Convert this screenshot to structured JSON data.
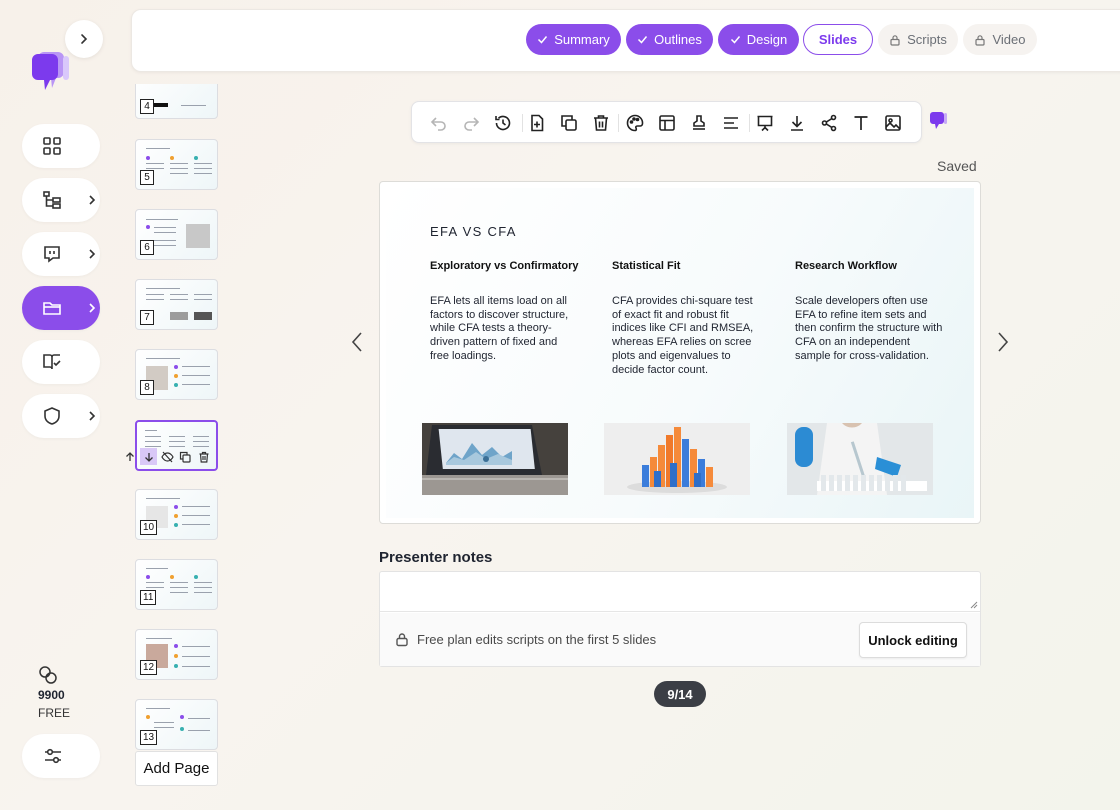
{
  "rail": {
    "items": [
      {
        "icon": "grid-icon",
        "has_chevron": false,
        "active": false
      },
      {
        "icon": "hierarchy-icon",
        "has_chevron": true,
        "active": false
      },
      {
        "icon": "chat-icon",
        "has_chevron": true,
        "active": false
      },
      {
        "icon": "folder-icon",
        "has_chevron": true,
        "active": true
      },
      {
        "icon": "book-check-icon",
        "has_chevron": false,
        "active": false
      },
      {
        "icon": "shield-icon",
        "has_chevron": true,
        "active": false
      }
    ],
    "credits": "9900",
    "plan": "FREE"
  },
  "steps": [
    {
      "label": "Summary",
      "state": "done"
    },
    {
      "label": "Outlines",
      "state": "done"
    },
    {
      "label": "Design",
      "state": "done"
    },
    {
      "label": "Slides",
      "state": "current"
    },
    {
      "label": "Scripts",
      "state": "locked"
    },
    {
      "label": "Video",
      "state": "locked"
    }
  ],
  "thumbnails": [
    "4",
    "5",
    "6",
    "7",
    "8",
    "",
    "10",
    "11",
    "12",
    "13"
  ],
  "selected_slide_index": 9,
  "add_page_label": "Add Page",
  "toolbar": {
    "tools": [
      "undo-icon",
      "redo-icon",
      "history-icon",
      "add-slide-icon",
      "duplicate-icon",
      "delete-icon",
      "palette-icon",
      "layout-icon",
      "stamp-icon",
      "align-icon",
      "present-icon",
      "download-icon",
      "share-icon",
      "text-icon",
      "image-icon"
    ]
  },
  "status": "Saved",
  "slide": {
    "title": "EFA VS CFA",
    "columns": [
      {
        "heading": "Exploratory vs Confirmatory",
        "body": "EFA lets all items load on all factors to discover structure, while CFA tests a theory-driven pattern of fixed and free loadings."
      },
      {
        "heading": "Statistical Fit",
        "body": "CFA provides chi-square test of exact fit and robust fit indices like CFI and RMSEA, whereas EFA relies on scree plots and eigenvalues to decide factor count."
      },
      {
        "heading": "Research Workflow",
        "body": "Scale developers often use EFA to refine item sets and then confirm the structure with CFA on an independent sample for cross-validation."
      }
    ]
  },
  "notes": {
    "heading": "Presenter notes",
    "value": "",
    "lock_message": "Free plan edits scripts on the first 5 slides",
    "unlock_label": "Unlock editing"
  },
  "pager": "9/14",
  "colors": {
    "accent": "#8b4dea",
    "pager_bg": "#3b3e45"
  }
}
